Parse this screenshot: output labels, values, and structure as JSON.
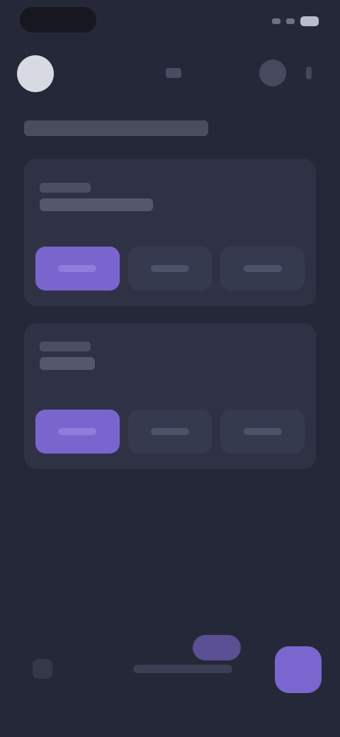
{
  "colors": {
    "background": "#252838",
    "card": "#2f3245",
    "segment": "#363a4f",
    "accent": "#7a65cf",
    "avatar": "#d7d9e3"
  },
  "status_bar": {
    "icons": [
      "signal-icon",
      "wifi-icon",
      "battery-icon"
    ]
  },
  "top_bar": {
    "icons": [
      "avatar",
      "center-icon",
      "action-icon",
      "more-icon"
    ]
  },
  "cards": [
    {
      "selected_segment": 0,
      "segment_count": 3
    },
    {
      "selected_segment": 0,
      "segment_count": 3
    }
  ],
  "bottom": {
    "icons": [
      "left-icon",
      "chat-bubble-icon",
      "fab-icon"
    ]
  }
}
